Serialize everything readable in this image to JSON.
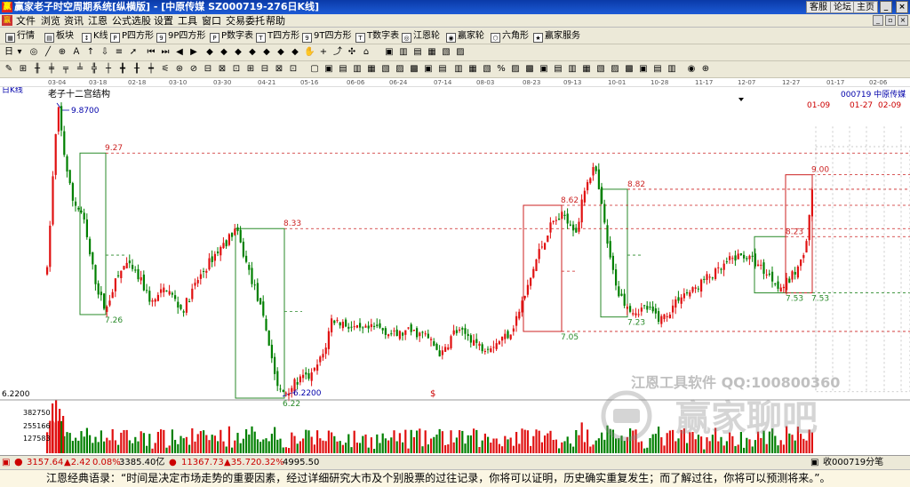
{
  "window": {
    "title": "赢家老子时空周期系统[纵横版] - [中原传媒  SZ000719-276日K线]",
    "links": [
      "客服",
      "论坛",
      "主页"
    ]
  },
  "menu": [
    "文件",
    "浏览",
    "资讯",
    "江恩",
    "公式选股",
    "设置",
    "工具",
    "窗口",
    "交易委托",
    "帮助"
  ],
  "toolbar1": [
    "行情",
    "板块",
    "K线",
    "P四方形",
    "9P四方形",
    "P数字表",
    "T四方形",
    "9T四方形",
    "T数字表",
    "江恩轮",
    "赢家轮",
    "六角形",
    "赢家服务"
  ],
  "dates": [
    "03-04",
    "03-18",
    "02-18",
    "03-10",
    "03-30",
    "04-21",
    "05-16",
    "06-06",
    "06-24",
    "07-14",
    "08-03",
    "08-23",
    "09-13",
    "10-01",
    "10-28",
    "11-17",
    "12-07",
    "12-27",
    "01-17",
    "02-06"
  ],
  "chart_header": {
    "type_label": "日K线",
    "structure_label": "老子十二宫结构",
    "stock_label": "000719  中原传媒",
    "top_dates": [
      "01-09",
      "01-27",
      "02-09"
    ],
    "ref_price": "6.2200"
  },
  "chart_data": {
    "type": "candlestick",
    "ylim": [
      5.5,
      10.0
    ],
    "high": 9.87,
    "low": 6.22,
    "annotations": [
      {
        "label": "9.8700",
        "price": 9.87
      },
      {
        "label": "9.27",
        "price": 9.27
      },
      {
        "label": "7.26",
        "price": 7.26
      },
      {
        "label": "8.33",
        "price": 8.33
      },
      {
        "label": "6.2200",
        "price": 6.22
      },
      {
        "label": "6.22",
        "price": 6.22
      },
      {
        "label": "8.62",
        "price": 8.62
      },
      {
        "label": "7.05",
        "price": 7.05
      },
      {
        "label": "8.82",
        "price": 8.82
      },
      {
        "label": "7.23",
        "price": 7.23
      },
      {
        "label": "9.00",
        "price": 9.0
      },
      {
        "label": "8.23",
        "price": 8.23
      },
      {
        "label": "7.53",
        "price": 7.53
      },
      {
        "label": "7.53",
        "price": 7.53
      }
    ],
    "volume_axis": [
      "382750",
      "255166",
      "127583"
    ]
  },
  "watermarks": {
    "software": "江恩工具软件  QQ:100800360",
    "forum": "赢家聊吧"
  },
  "status": {
    "sh_index": "3157.64",
    "sh_change": "▲2.42",
    "sh_pct": "0.08%",
    "sh_amount": "3385.40亿",
    "sz_index": "11367.73",
    "sz_change": "▲35.72",
    "sz_pct": "0.32%",
    "sz_amount": "4995.50",
    "right_text": "收000719分笔"
  },
  "quote": "江恩经典语录：“时间是决定市场走势的重要因素，经过详细研究大市及个别股票的过往记录，你将可以证明，历史确实重复发生；而了解过往，你将可以预测将来。”。",
  "colors": {
    "up": "#e01010",
    "down": "#008000",
    "bg": "#ffffff"
  }
}
